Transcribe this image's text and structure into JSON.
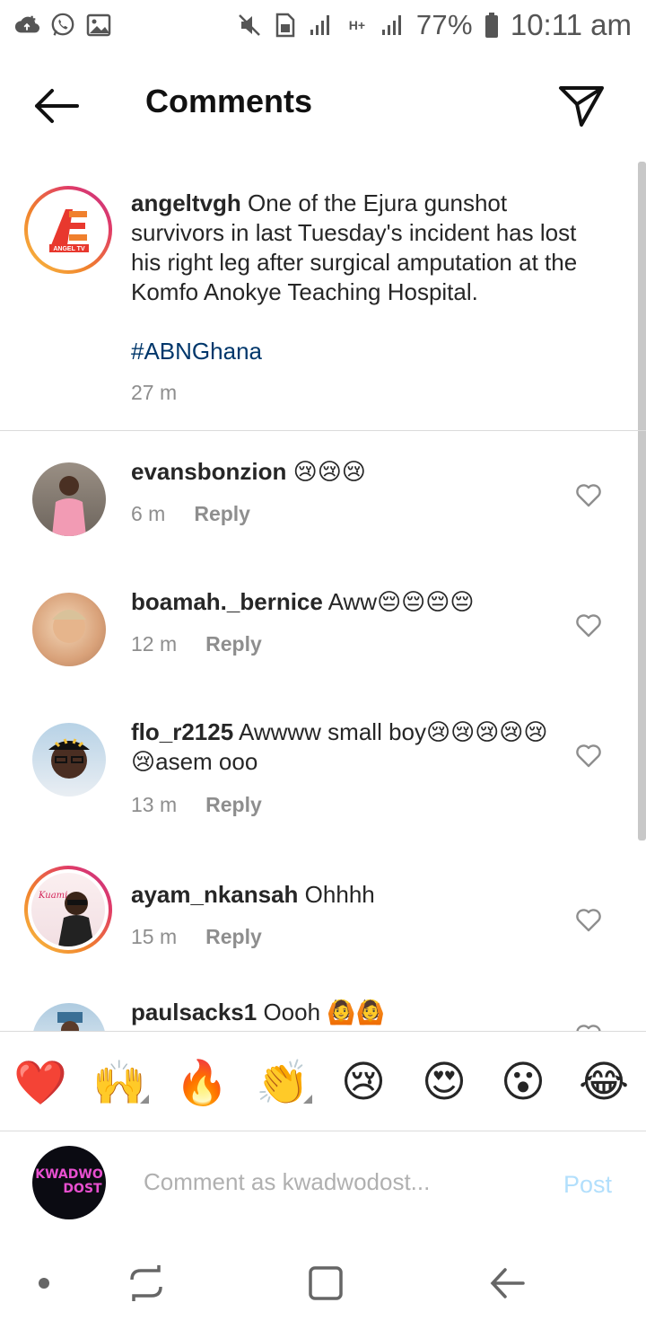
{
  "status_bar": {
    "battery_percent": "77%",
    "time": "10:11 am",
    "network_label": "H+"
  },
  "header": {
    "title": "Comments"
  },
  "caption": {
    "username": "angeltvgh",
    "text": " One of the Ejura gunshot survivors in last Tuesday's incident has lost his right leg after surgical amputation at the Komfo Anokye Teaching Hospital.",
    "hashtag": "#ABNGhana",
    "time": "27 m",
    "avatar_logo_text": "ANGEL TV"
  },
  "comments": [
    {
      "username": "evansbonzion",
      "text": " 😢😢😢",
      "time": "6 m",
      "reply_label": "Reply"
    },
    {
      "username": "boamah._bernice",
      "text": " Aww😔😔😔😔",
      "time": "12 m",
      "reply_label": "Reply"
    },
    {
      "username": "flo_r2125",
      "text": " Awwww small boy😢😢😢😢😢😢asem ooo",
      "time": "13 m",
      "reply_label": "Reply"
    },
    {
      "username": "ayam_nkansah",
      "text": " Ohhhh",
      "time": "15 m",
      "reply_label": "Reply"
    },
    {
      "username": "paulsacks1",
      "text": " Oooh 🙆🙆",
      "time": "",
      "reply_label": ""
    }
  ],
  "emoji_bar": [
    "❤️",
    "🙌",
    "🔥",
    "👏",
    "😢",
    "😍",
    "😮",
    "😂"
  ],
  "comment_input": {
    "placeholder": "Comment as kwadwodost...",
    "post_label": "Post",
    "avatar_text_1": "KWADWO",
    "avatar_text_2": "DOST"
  },
  "colors": {
    "hashtag": "#00376b",
    "secondary_text": "#8e8e8e",
    "post_disabled": "#b2dffc",
    "story_ring_start": "#f9c243",
    "story_ring_end": "#c23389"
  }
}
